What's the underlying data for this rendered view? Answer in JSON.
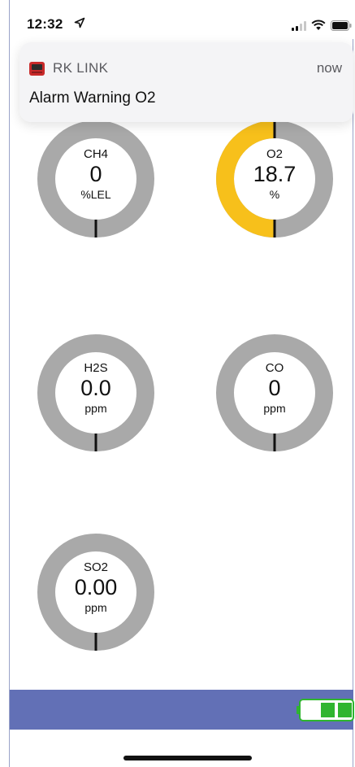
{
  "status_bar": {
    "time": "12:32",
    "icons": [
      "location-arrow-icon",
      "signal-icon",
      "wifi-icon",
      "battery-icon"
    ]
  },
  "notification": {
    "app_name": "RK LINK",
    "time": "now",
    "message": "Alarm Warning O2",
    "app_icon": "rk-link-app-icon"
  },
  "gauges": [
    {
      "name": "CH4",
      "value": "0",
      "unit": "%LEL",
      "fill_fraction": 0,
      "alarm": false
    },
    {
      "name": "O2",
      "value": "18.7",
      "unit": "%",
      "fill_fraction": 0.5,
      "alarm": true,
      "alarm_color": "#f7c01b"
    },
    {
      "name": "H2S",
      "value": "0.0",
      "unit": "ppm",
      "fill_fraction": 0,
      "alarm": false
    },
    {
      "name": "CO",
      "value": "0",
      "unit": "ppm",
      "fill_fraction": 0,
      "alarm": false
    },
    {
      "name": "SO2",
      "value": "0.00",
      "unit": "ppm",
      "fill_fraction": 0,
      "alarm": false
    }
  ],
  "colors": {
    "ring_gray": "#a9a9a9",
    "alarm_yellow": "#f7c01b",
    "bottom_bar": "#6270b6",
    "battery_green": "#2fb52f"
  },
  "device_battery": {
    "icon": "device-battery-icon",
    "level_fraction": 0.67
  }
}
